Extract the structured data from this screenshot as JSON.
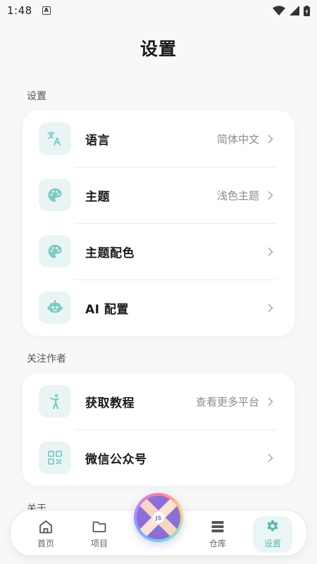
{
  "status_bar": {
    "time": "1:48",
    "a_badge": "A"
  },
  "page_title": "设置",
  "sections": {
    "settings": {
      "label": "设置",
      "items": [
        {
          "icon": "translate-icon",
          "label": "语言",
          "value": "简体中文"
        },
        {
          "icon": "palette-icon",
          "label": "主题",
          "value": "浅色主题"
        },
        {
          "icon": "palette-icon",
          "label": "主题配色",
          "value": ""
        },
        {
          "icon": "robot-icon",
          "label": "AI 配置",
          "value": ""
        }
      ]
    },
    "follow": {
      "label": "关注作者",
      "items": [
        {
          "icon": "person-icon",
          "label": "获取教程",
          "value": "查看更多平台"
        },
        {
          "icon": "qrcode-icon",
          "label": "微信公众号",
          "value": ""
        }
      ]
    },
    "about": {
      "label": "关于"
    }
  },
  "bottom_nav": {
    "items": [
      {
        "icon": "home-icon",
        "label": "首页"
      },
      {
        "icon": "folder-icon",
        "label": "项目"
      },
      {
        "icon": "repo-icon",
        "label": "仓库"
      },
      {
        "icon": "gear-icon",
        "label": "设置",
        "active": true
      }
    ],
    "fab_badge": "JS"
  },
  "colors": {
    "accent": "#5fb7b3",
    "icon_bg": "#e9f5f4",
    "background": "#f7f8f8"
  }
}
